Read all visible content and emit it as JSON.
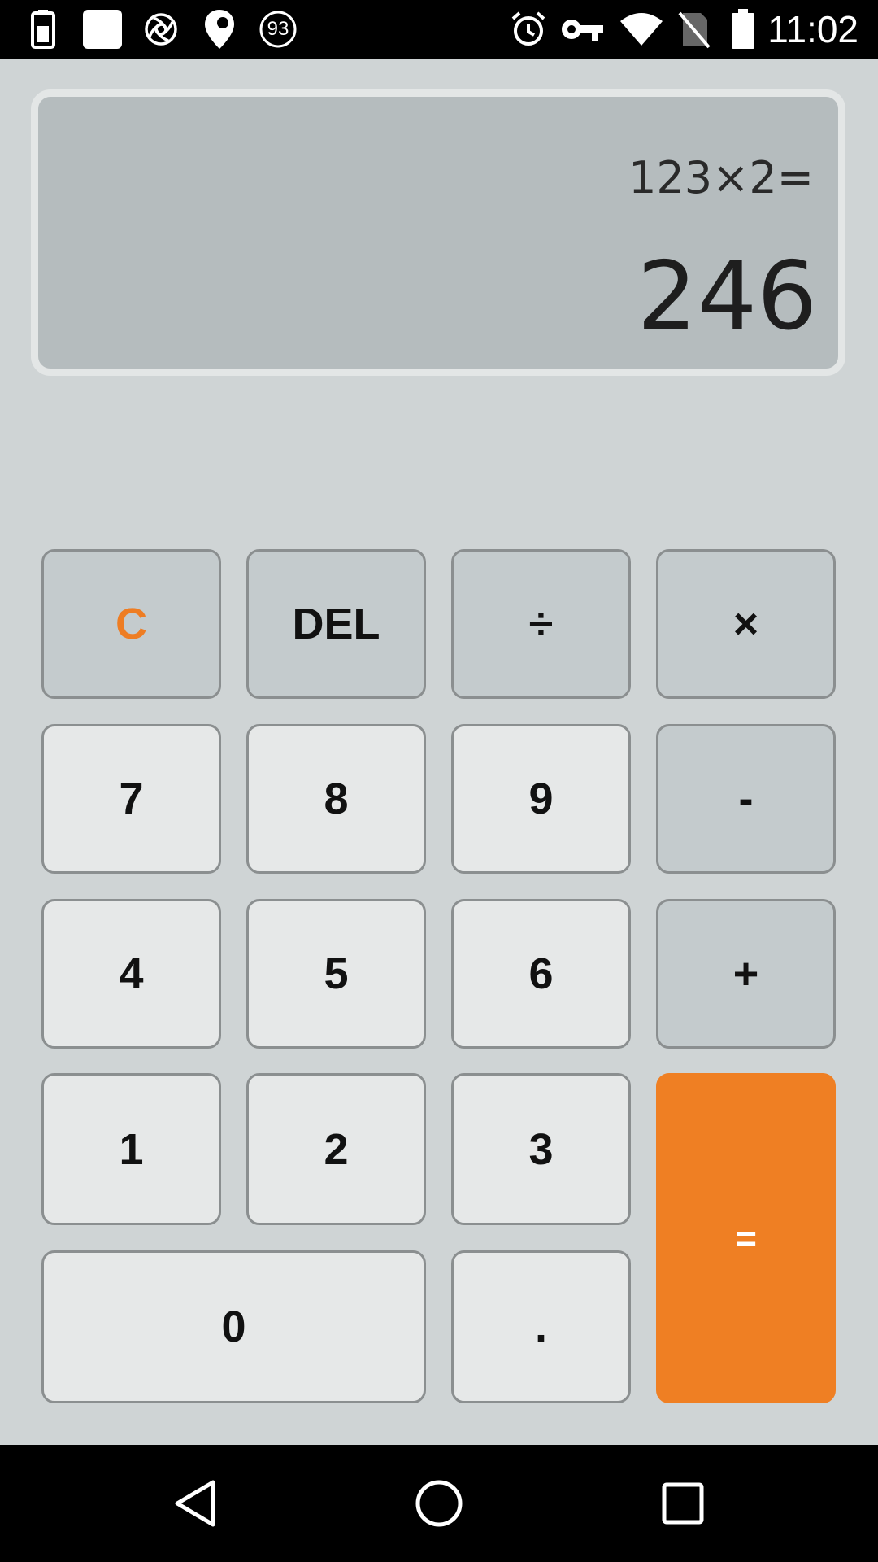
{
  "status_bar": {
    "notification_count": "93",
    "time": "11:02",
    "icons": [
      "battery-saver-icon",
      "app-square-icon",
      "spiral-icon",
      "location-pin-icon",
      "notification-count-icon",
      "alarm-icon",
      "vpn-key-icon",
      "wifi-icon",
      "no-sim-icon",
      "battery-icon"
    ]
  },
  "display": {
    "expression": "123×2=",
    "result": "246"
  },
  "keypad": {
    "clear": "C",
    "delete": "DEL",
    "divide": "÷",
    "multiply": "×",
    "seven": "7",
    "eight": "8",
    "nine": "9",
    "subtract": "-",
    "four": "4",
    "five": "5",
    "six": "6",
    "add": "+",
    "one": "1",
    "two": "2",
    "three": "3",
    "equals": "=",
    "zero": "0",
    "decimal": "."
  },
  "colors": {
    "accent": "#ef7f23",
    "background": "#cfd4d5",
    "display_bg": "#b5bcbe",
    "digit_key": "#e6e8e8",
    "operator_key": "#c4cbcd"
  },
  "nav_bar": {
    "icons": [
      "back-icon",
      "home-icon",
      "recents-icon"
    ]
  }
}
